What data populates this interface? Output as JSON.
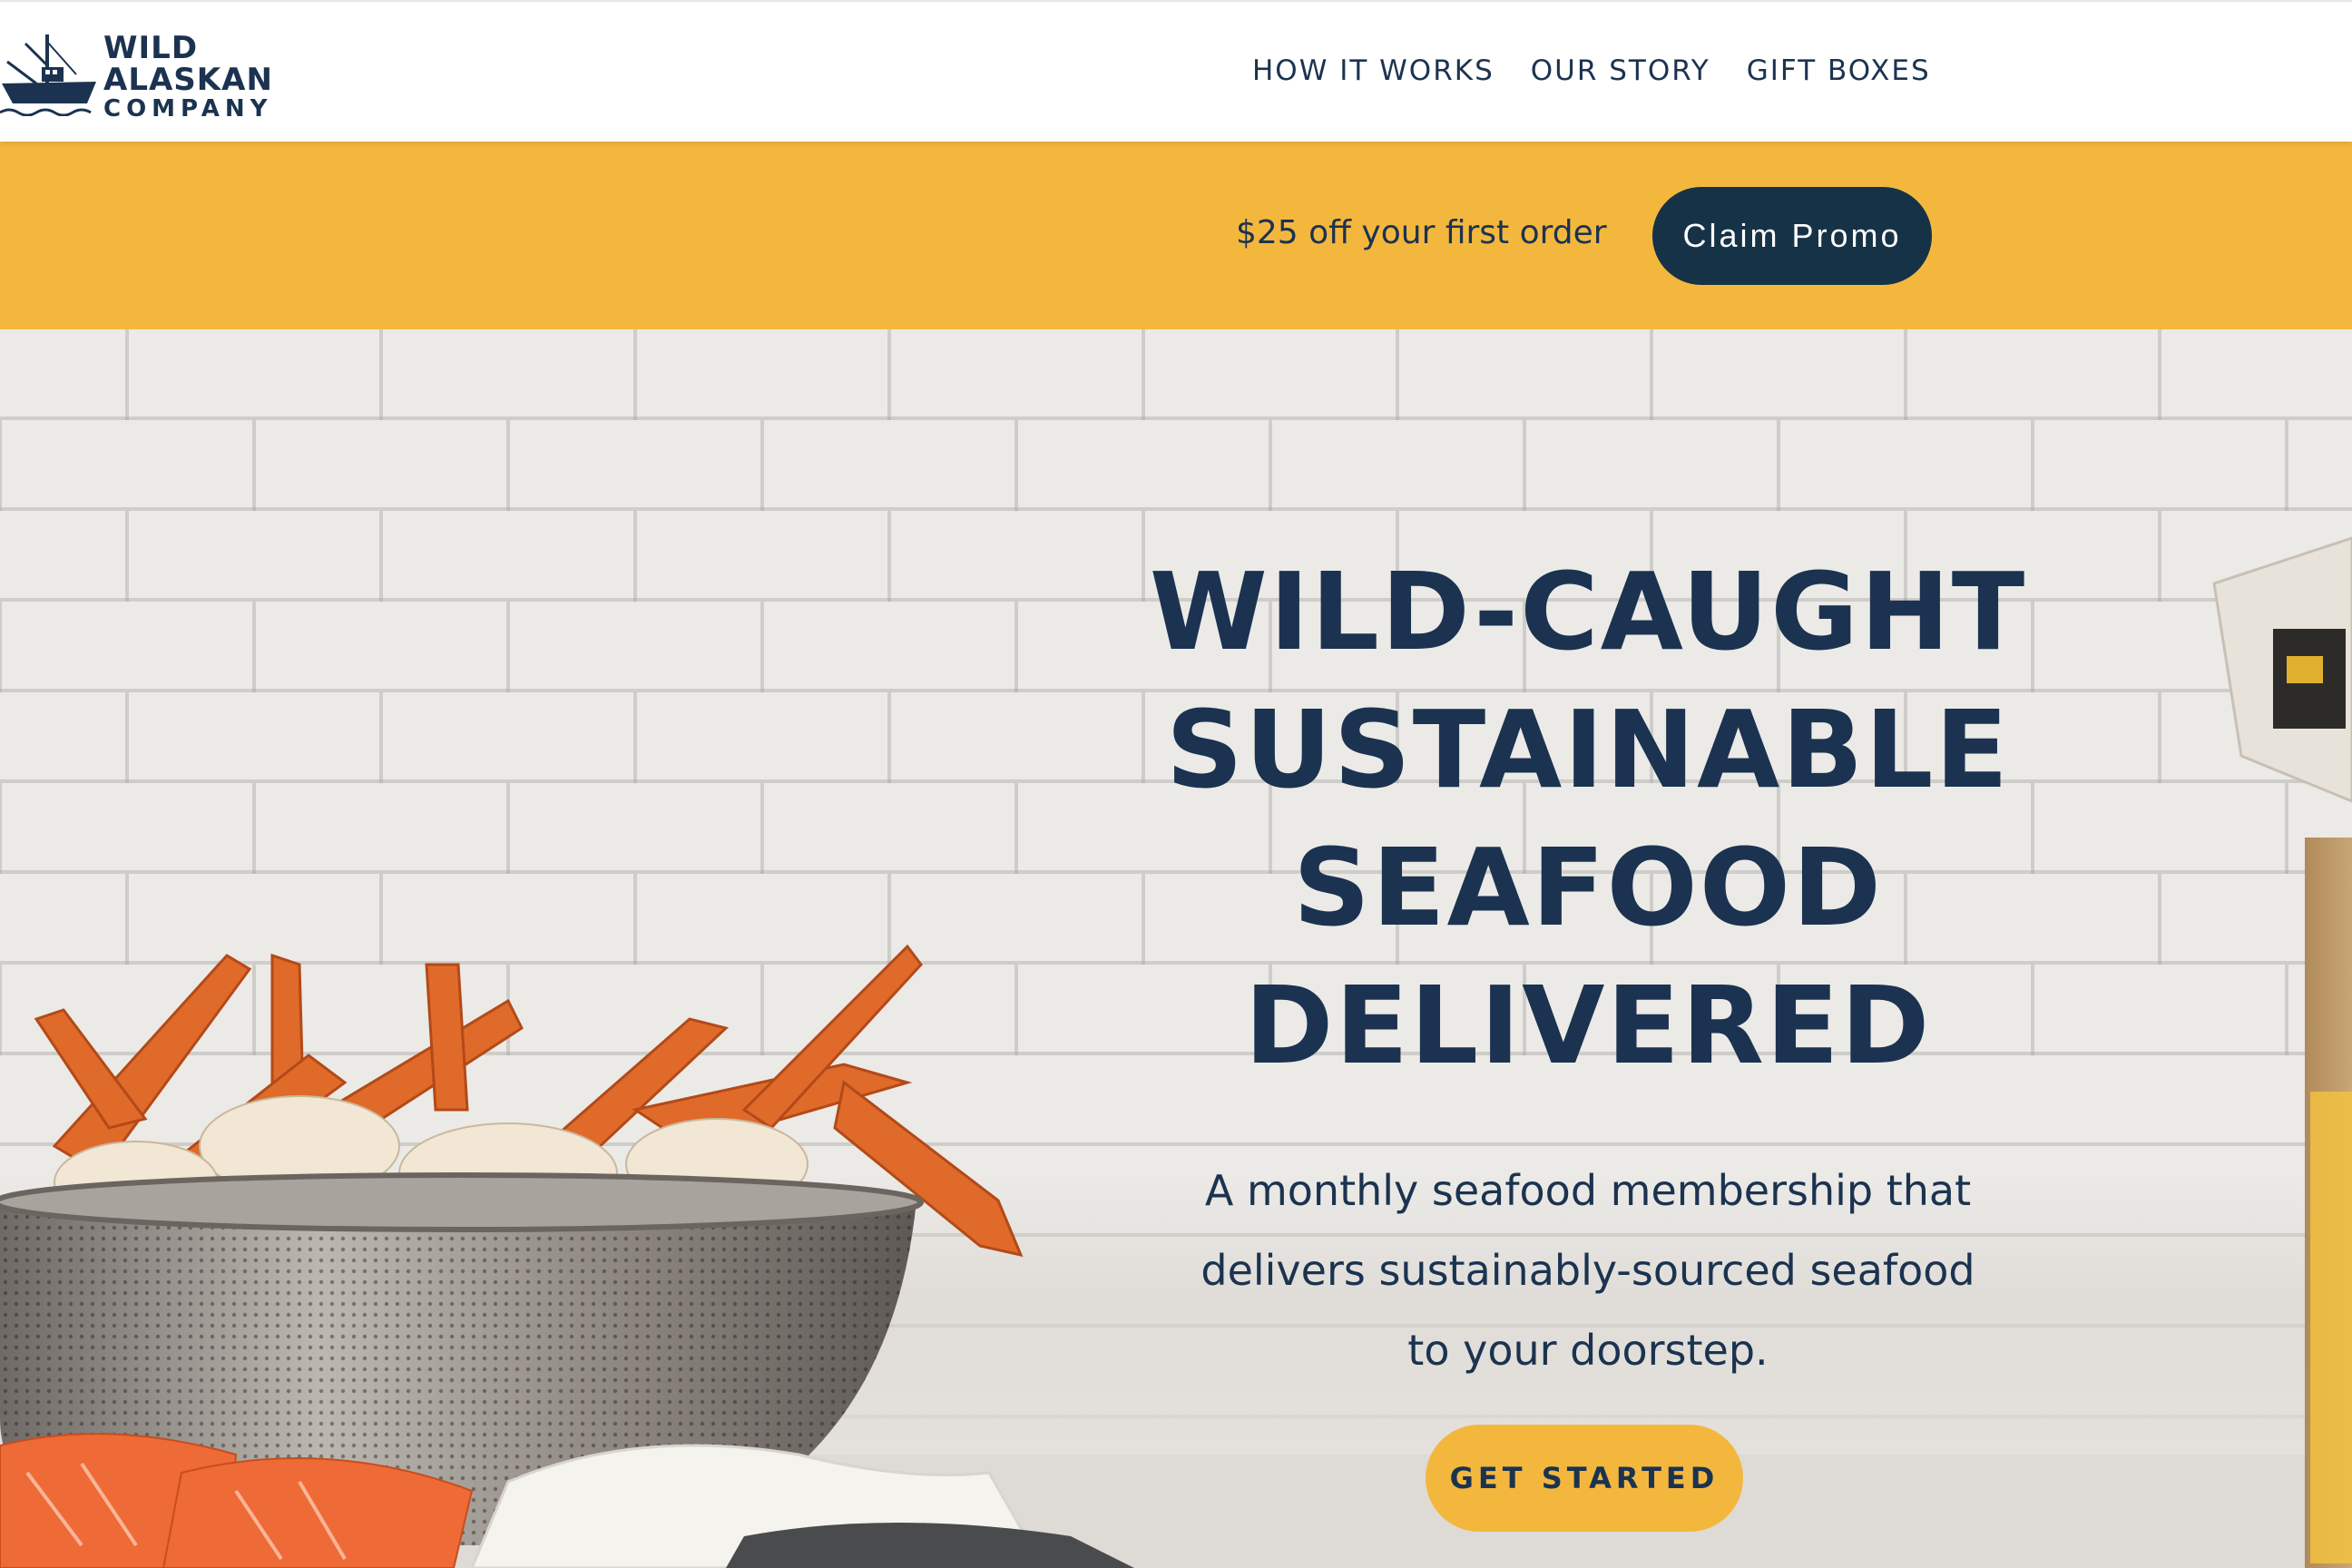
{
  "brand": {
    "line1": "WILD",
    "line2": "ALASKAN",
    "line3": "COMPANY"
  },
  "nav": {
    "how_it_works": "HOW IT WORKS",
    "our_story": "OUR STORY",
    "gift_boxes": "GIFT BOXES"
  },
  "promo": {
    "text": "$25 off your first order",
    "button": "Claim Promo"
  },
  "hero": {
    "headline": [
      "WILD-CAUGHT",
      "SUSTAINABLE",
      "SEAFOOD",
      "DELIVERED"
    ],
    "subhead": [
      "A monthly seafood membership that",
      "delivers sustainably-sourced seafood",
      "to your doorstep."
    ],
    "cta": "GET STARTED"
  },
  "colors": {
    "navy": "#1b3350",
    "button_navy": "#163247",
    "accent_yellow": "#f4b73e",
    "background": "#ffffff"
  },
  "icons": {
    "logo": "fishing-boat-logo-icon"
  }
}
